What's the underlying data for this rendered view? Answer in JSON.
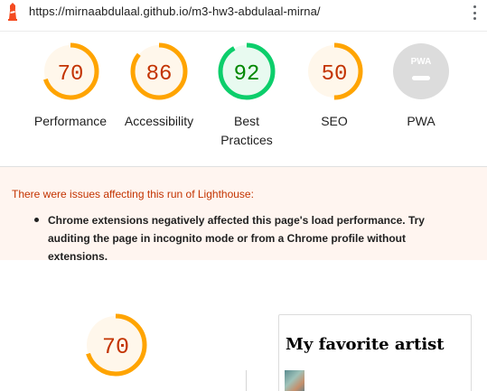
{
  "topbar": {
    "url": "https://mirnaabdulaal.github.io/m3-hw3-abdulaal-mirna/",
    "logo_icon": "lighthouse-icon",
    "menu_icon": "kebab-menu-icon"
  },
  "colors": {
    "average": "#ffa400",
    "average_text": "#c33300",
    "pass": "#0cce6b",
    "pass_text": "#008800",
    "na": "#cccccc",
    "warning_bg": "#fff5f0"
  },
  "gauges": [
    {
      "label": "Performance",
      "score": "70",
      "fraction": 0.7
    },
    {
      "label": "Accessibility",
      "score": "86",
      "fraction": 0.86
    },
    {
      "label": "Best Practices",
      "score": "92",
      "fraction": 0.92
    },
    {
      "label": "SEO",
      "score": "50",
      "fraction": 0.5
    },
    {
      "label": "PWA",
      "score": "",
      "badge": "PWA"
    }
  ],
  "warning": {
    "title": "There were issues affecting this run of Lighthouse:",
    "items": [
      "Chrome extensions negatively affected this page's load performance. Try auditing the page in incognito mode or from a Chrome profile without extensions."
    ]
  },
  "performance_section": {
    "score": "70",
    "fraction": 0.7
  },
  "preview": {
    "heading": "My favorite artist"
  }
}
